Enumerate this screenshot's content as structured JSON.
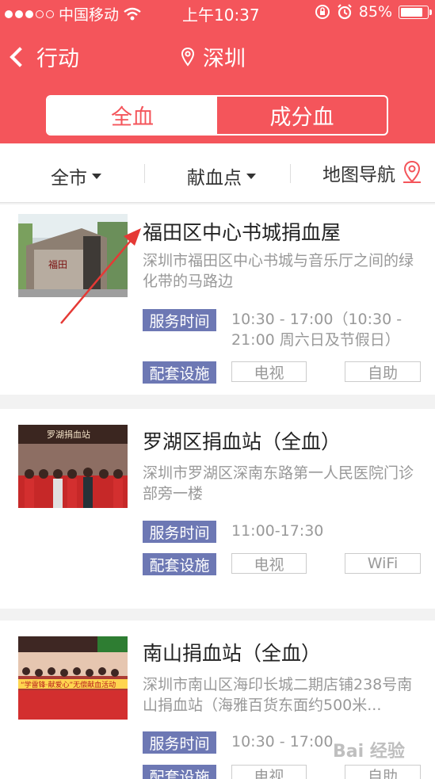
{
  "status_bar": {
    "carrier": "中国移动",
    "time": "上午10:37",
    "battery": "85%",
    "battery_level": 0.85
  },
  "nav": {
    "back_label": "行动",
    "city": "深圳"
  },
  "segments": [
    {
      "label": "全血"
    },
    {
      "label": "成分血"
    }
  ],
  "filters": {
    "area": "全市",
    "site": "献血点",
    "map": "地图导航"
  },
  "stations": [
    {
      "name": "福田区中心书城捐血屋",
      "address": "深圳市福田区中心书城与音乐厅之间的绿化带的马路边",
      "hours_label": "服务时间",
      "hours": "10:30 - 17:00（10:30 - 21:00 周六日及节假日）",
      "facilities_label": "配套设施",
      "facilities": [
        "电视",
        "自助"
      ],
      "photo_text": "福田"
    },
    {
      "name": "罗湖区捐血站（全血）",
      "address": "深圳市罗湖区深南东路第一人民医院门诊部旁一楼",
      "hours_label": "服务时间",
      "hours": "11:00-17:30",
      "facilities_label": "配套设施",
      "facilities": [
        "电视",
        "WiFi"
      ],
      "photo_text": "罗湖捐血站"
    },
    {
      "name": "南山捐血站（全血）",
      "address": "深圳市南山区海印长城二期店铺238号南山捐血站（海雅百货东面约500米...",
      "hours_label": "服务时间",
      "hours": "10:30 - 17:00",
      "facilities_label": "配套设施",
      "facilities": [
        "电视",
        "自助"
      ],
      "photo_text": "“学雷锋·献爱心”无偿献血活动"
    }
  ],
  "watermark": "Bai 经验",
  "colors": {
    "brand": "#f4555b",
    "tag": "#6d78b4",
    "arrow": "#e53935"
  }
}
